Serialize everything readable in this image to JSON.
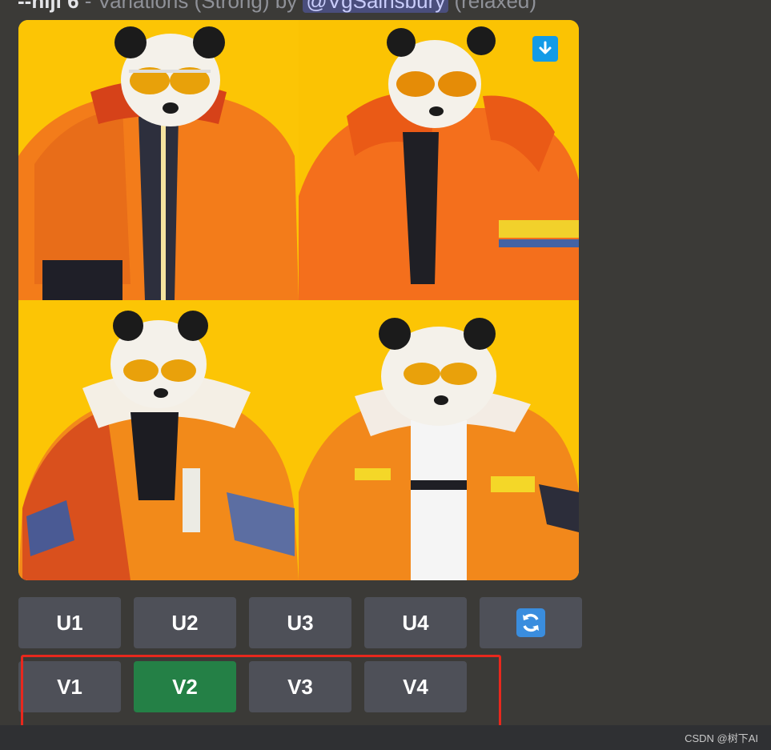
{
  "header": {
    "command": "--niji 6",
    "separator": " - ",
    "variation_text": "Variations (Strong) by ",
    "mention": "@VgSainsbury",
    "mode": " (relaxed)"
  },
  "grid": {
    "background": "#f9c404",
    "download_icon": "arrow-down-icon"
  },
  "upscale_buttons": [
    "U1",
    "U2",
    "U3",
    "U4"
  ],
  "reroll_icon": "refresh-icon",
  "variation_buttons": [
    "V1",
    "V2",
    "V3",
    "V4"
  ],
  "active_variation": "V2",
  "colors": {
    "button": "#4e5058",
    "button_active": "#248046",
    "highlight": "#e8281d",
    "reroll": "#3a8dde"
  },
  "watermark": "CSDN @树下AI"
}
